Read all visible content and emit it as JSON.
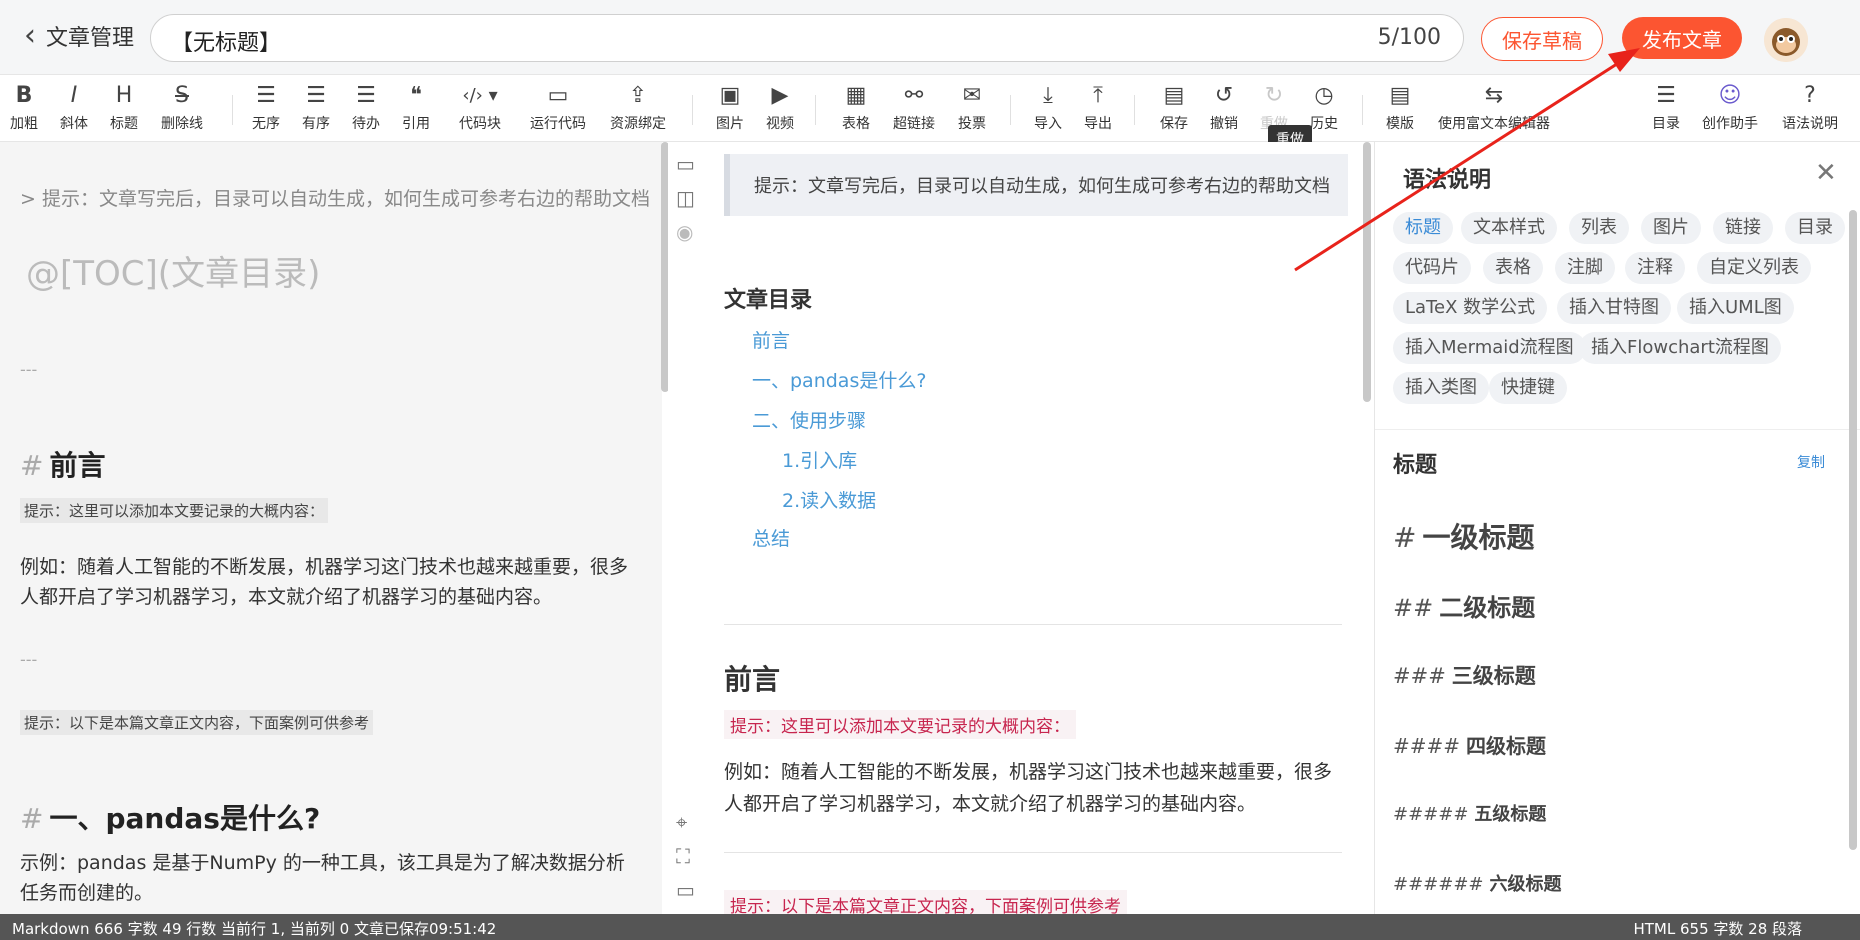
{
  "header": {
    "back_label": "文章管理",
    "title_value": "【无标题】",
    "title_count": "5/100",
    "save_draft_label": "保存草稿",
    "publish_label": "发布文章"
  },
  "toolbar": {
    "bold": {
      "icon": "B",
      "label": "加粗"
    },
    "italic": {
      "icon": "I",
      "label": "斜体"
    },
    "heading": {
      "icon": "H",
      "label": "标题"
    },
    "strike": {
      "icon": "S",
      "label": "删除线"
    },
    "ul": {
      "icon": "☰",
      "label": "无序"
    },
    "ol": {
      "icon": "☰",
      "label": "有序"
    },
    "todo": {
      "icon": "☰",
      "label": "待办"
    },
    "quote": {
      "icon": "❝",
      "label": "引用"
    },
    "code": {
      "icon": "‹/› ▾",
      "label": "代码块"
    },
    "run": {
      "icon": "▭",
      "label": "运行代码"
    },
    "resource": {
      "icon": "⇪",
      "label": "资源绑定"
    },
    "image": {
      "icon": "▣",
      "label": "图片"
    },
    "video": {
      "icon": "▶",
      "label": "视频"
    },
    "table": {
      "icon": "▦",
      "label": "表格"
    },
    "link": {
      "icon": "⚯",
      "label": "超链接"
    },
    "vote": {
      "icon": "✉",
      "label": "投票"
    },
    "import": {
      "icon": "⤓",
      "label": "导入"
    },
    "export": {
      "icon": "⤒",
      "label": "导出"
    },
    "save": {
      "icon": "▤",
      "label": "保存"
    },
    "undo": {
      "icon": "↺",
      "label": "撤销"
    },
    "redo": {
      "icon": "↻",
      "label": "重做"
    },
    "history": {
      "icon": "◷",
      "label": "历史"
    },
    "template": {
      "icon": "▤",
      "label": "模版"
    },
    "rich": {
      "icon": "⇆",
      "label": "使用富文本编辑器"
    },
    "toc": {
      "icon": "☰",
      "label": "目录"
    },
    "assistant": {
      "icon": "☺",
      "label": "创作助手"
    },
    "syntax": {
      "icon": "?",
      "label": "语法说明"
    },
    "tooltip": "重做"
  },
  "editor": {
    "hint": "> 提示：文章写完后，目录可以自动生成，如何生成可参考右边的帮助文档",
    "toc": "@[TOC](文章目录)",
    "hr1": "---",
    "hash": "#",
    "h_preface": "前言",
    "tip1": "提示：这里可以添加本文要记录的大概内容：",
    "para1": "例如：随着人工智能的不断发展，机器学习这门技术也越来越重要，很多人都开启了学习机器学习，本文就介绍了机器学习的基础内容。",
    "hr2": "---",
    "tip2": "提示：以下是本篇文章正文内容，下面案例可供参考",
    "h_pandas": "一、pandas是什么?",
    "para2": "示例：pandas 是基于NumPy 的一种工具，该工具是为了解决数据分析任务而创建的。"
  },
  "preview": {
    "quote": "提示：文章写完后，目录可以自动生成，如何生成可参考右边的帮助文档",
    "toc_title": "文章目录",
    "toc_items": [
      "前言",
      "一、pandas是什么?",
      "二、使用步骤",
      "1.引入库",
      "2.读入数据",
      "总结"
    ],
    "h_preface": "前言",
    "tip1": "提示：这里可以添加本文要记录的大概内容：",
    "para1": "例如：随着人工智能的不断发展，机器学习这门技术也越来越重要，很多人都开启了学习机器学习，本文就介绍了机器学习的基础内容。",
    "tip2": "提示：以下是本篇文章正文内容，下面案例可供参考"
  },
  "help": {
    "title": "语法说明",
    "tags": [
      "标题",
      "文本样式",
      "列表",
      "图片",
      "链接",
      "目录",
      "代码片",
      "表格",
      "注脚",
      "注释",
      "自定义列表",
      "LaTeX 数学公式",
      "插入甘特图",
      "插入UML图",
      "插入Mermaid流程图",
      "插入Flowchart流程图",
      "插入类图",
      "快捷键"
    ],
    "section_title": "标题",
    "copy": "复制",
    "levels": [
      {
        "marks": "#",
        "text": "一级标题"
      },
      {
        "marks": "##",
        "text": "二级标题"
      },
      {
        "marks": "###",
        "text": "三级标题"
      },
      {
        "marks": "####",
        "text": "四级标题"
      },
      {
        "marks": "#####",
        "text": "五级标题"
      },
      {
        "marks": "######",
        "text": "六级标题"
      }
    ]
  },
  "status": {
    "left": "Markdown  666 字数  49 行数  当前行 1, 当前列 0  文章已保存09:51:42",
    "right": "HTML  655 字数  28 段落"
  },
  "colors": {
    "accent": "#fc5531",
    "link": "#4a9ad6",
    "tip_red": "#c7254e"
  }
}
